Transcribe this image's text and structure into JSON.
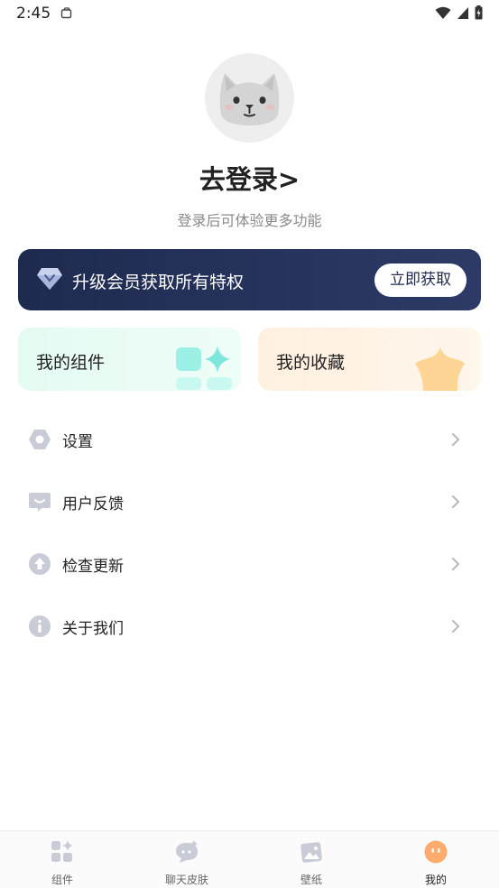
{
  "status_bar": {
    "time": "2:45"
  },
  "profile": {
    "login_title": "去登录>",
    "login_subtitle": "登录后可体验更多功能"
  },
  "vip_banner": {
    "text": "升级会员获取所有特权",
    "button_label": "立即获取"
  },
  "cards": [
    {
      "label": "我的组件",
      "icon": "widgets-sparkle-icon",
      "color": "#7ee6dc"
    },
    {
      "label": "我的收藏",
      "icon": "star-icon",
      "color": "#ffd28c"
    }
  ],
  "menu": [
    {
      "label": "设置",
      "icon": "hexagon-settings-icon"
    },
    {
      "label": "用户反馈",
      "icon": "chat-feedback-icon"
    },
    {
      "label": "检查更新",
      "icon": "upload-arrow-icon"
    },
    {
      "label": "关于我们",
      "icon": "info-icon"
    }
  ],
  "bottom_nav": {
    "items": [
      {
        "label": "组件",
        "icon": "widgets-icon",
        "active": false
      },
      {
        "label": "聊天皮肤",
        "icon": "chat-skin-icon",
        "active": false
      },
      {
        "label": "壁纸",
        "icon": "wallpaper-icon",
        "active": false
      },
      {
        "label": "我的",
        "icon": "profile-face-icon",
        "active": true
      }
    ],
    "active_color": "#ffab6e",
    "inactive_color": "#c9ccd6"
  }
}
